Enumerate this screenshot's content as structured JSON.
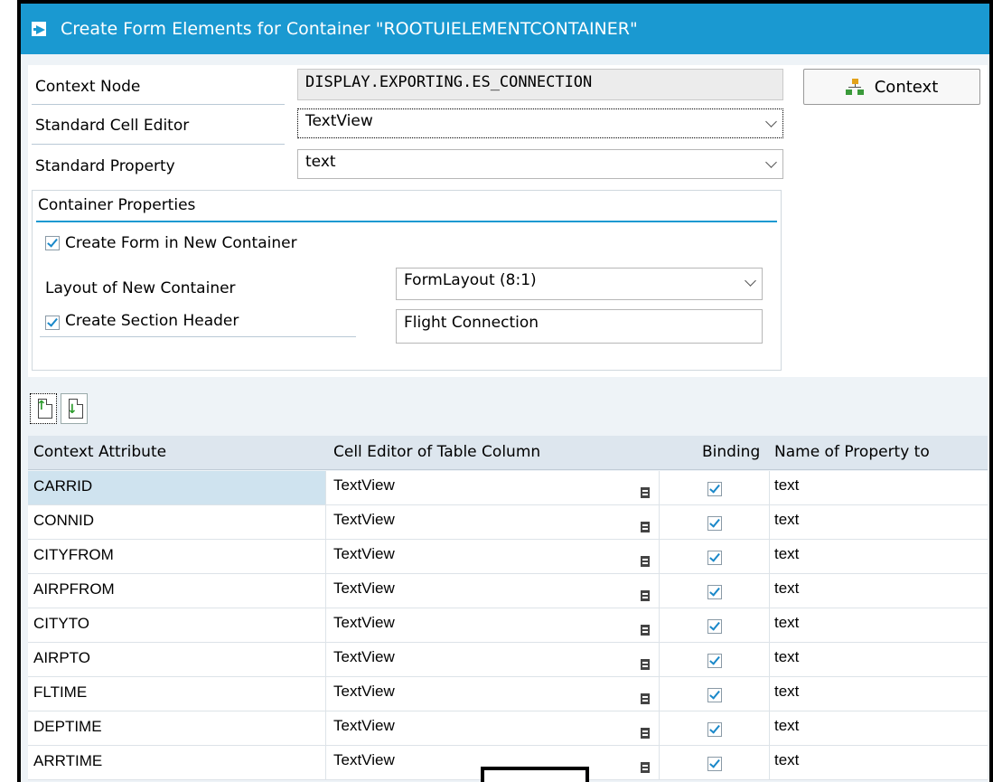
{
  "window": {
    "title": "Create Form Elements for Container \"ROOTUIELEMENTCONTAINER\""
  },
  "form": {
    "context_node_label": "Context Node",
    "context_node_value": "DISPLAY.EXPORTING.ES_CONNECTION",
    "context_button_label": "Context",
    "cell_editor_label": "Standard Cell Editor",
    "cell_editor_value": "TextView",
    "property_label": "Standard Property",
    "property_value": "text"
  },
  "container_group": {
    "title": "Container Properties",
    "create_form_label": "Create Form in New Container",
    "create_form_checked": true,
    "layout_label": "Layout of New Container",
    "layout_value": "FormLayout (8:1)",
    "section_header_label": "Create Section Header",
    "section_header_checked": true,
    "section_header_value": "Flight Connection"
  },
  "table": {
    "columns": [
      "Context Attribute",
      "Cell Editor of Table Column",
      "Binding",
      "Name of Property to"
    ],
    "rows": [
      {
        "attribute": "CARRID",
        "editor": "TextView",
        "binding": true,
        "property": "text"
      },
      {
        "attribute": "CONNID",
        "editor": "TextView",
        "binding": true,
        "property": "text"
      },
      {
        "attribute": "CITYFROM",
        "editor": "TextView",
        "binding": true,
        "property": "text"
      },
      {
        "attribute": "AIRPFROM",
        "editor": "TextView",
        "binding": true,
        "property": "text"
      },
      {
        "attribute": "CITYTO",
        "editor": "TextView",
        "binding": true,
        "property": "text"
      },
      {
        "attribute": "AIRPTO",
        "editor": "TextView",
        "binding": true,
        "property": "text"
      },
      {
        "attribute": "FLTIME",
        "editor": "TextView",
        "binding": true,
        "property": "text"
      },
      {
        "attribute": "DEPTIME",
        "editor": "TextView",
        "binding": true,
        "property": "text"
      },
      {
        "attribute": "ARRTIME",
        "editor": "TextView",
        "binding": true,
        "property": "text"
      }
    ]
  },
  "colors": {
    "title_bar": "#1a99d1",
    "checkbox_tick": "#1a88c9",
    "selected_row": "#cfe3ef"
  }
}
